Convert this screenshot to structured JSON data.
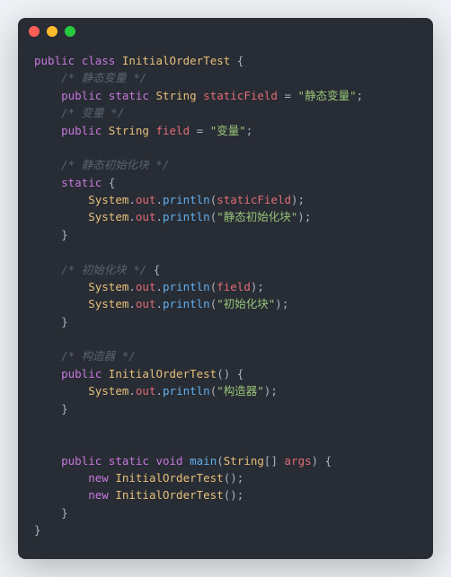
{
  "window": {
    "dots": [
      "red",
      "yellow",
      "green"
    ]
  },
  "code": {
    "kw_public": "public",
    "kw_class": "class",
    "kw_static": "static",
    "kw_void": "void",
    "kw_new": "new",
    "type_String": "String",
    "type_System": "System",
    "class_name": "InitialOrderTest",
    "field_out": "out",
    "fn_println": "println",
    "fn_main": "main",
    "ident_staticField": "staticField",
    "ident_field": "field",
    "ident_args": "args",
    "str_staticField": "\"静态变量\"",
    "str_field": "\"变量\"",
    "str_staticInit": "\"静态初始化块\"",
    "str_init": "\"初始化块\"",
    "str_ctor": "\"构造器\"",
    "cm_staticField": "/* 静态变量 */",
    "cm_field": "/* 变量 */",
    "cm_staticInit": "/* 静态初始化块 */",
    "cm_init": "/* 初始化块 */",
    "cm_ctor": "/* 构造器 */",
    "brackets": "[]"
  }
}
